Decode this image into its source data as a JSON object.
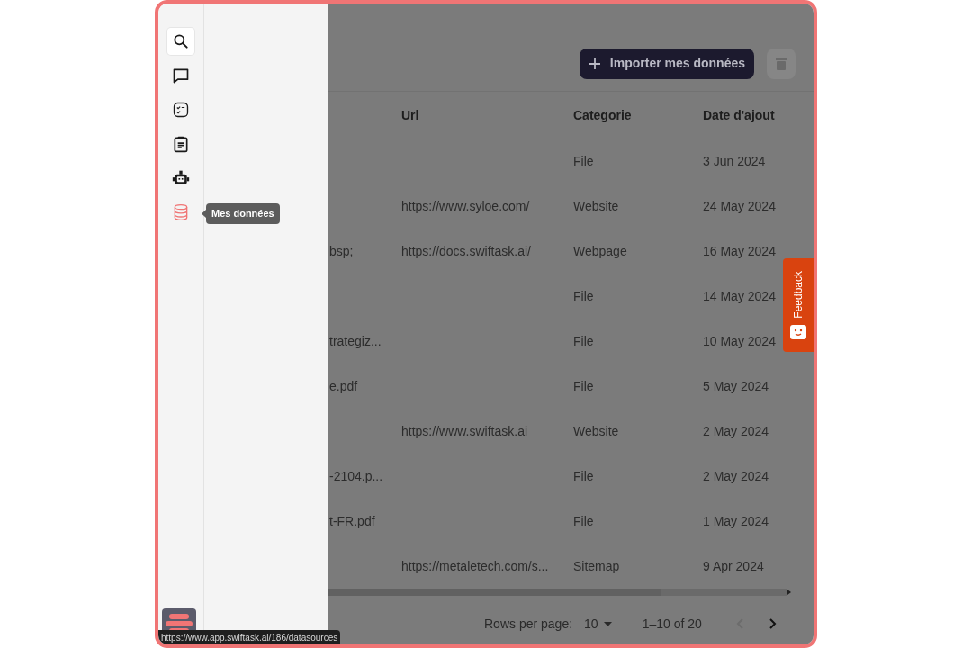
{
  "sidebar": {
    "items": [
      {
        "kind": "search",
        "selected": false,
        "focused": true
      },
      {
        "kind": "chat",
        "selected": false,
        "focused": false
      },
      {
        "kind": "checklist",
        "selected": false,
        "focused": false
      },
      {
        "kind": "clipboard",
        "selected": false,
        "focused": false
      },
      {
        "kind": "robot",
        "selected": false,
        "focused": false
      },
      {
        "kind": "database",
        "selected": true,
        "focused": false
      }
    ],
    "tooltip": "Mes données"
  },
  "toolbar": {
    "import_button": "Importer mes données",
    "delete_disabled": true
  },
  "table": {
    "columns": [
      "Url",
      "Categorie",
      "Date d'ajout"
    ],
    "rows": [
      {
        "column_1": "",
        "url": "",
        "category": "File",
        "date": "3 Jun 2024"
      },
      {
        "column_1": "",
        "url": "https://www.syloe.com/",
        "category": "Website",
        "date": "24 May 2024"
      },
      {
        "column_1": "bsp;",
        "url": "https://docs.swiftask.ai/",
        "category": "Webpage",
        "date": "16 May 2024"
      },
      {
        "column_1": "",
        "url": "",
        "category": "File",
        "date": "14 May 2024"
      },
      {
        "column_1": "trategiz...",
        "url": "",
        "category": "File",
        "date": "10 May 2024"
      },
      {
        "column_1": "e.pdf",
        "url": "",
        "category": "File",
        "date": "5 May 2024"
      },
      {
        "column_1": "",
        "url": "https://www.swiftask.ai",
        "category": "Website",
        "date": "2 May 2024"
      },
      {
        "column_1": "-2104.p...",
        "url": "",
        "category": "File",
        "date": "2 May 2024"
      },
      {
        "column_1": "t-FR.pdf",
        "url": "",
        "category": "File",
        "date": "1 May 2024"
      },
      {
        "column_1": "",
        "url": "https://metaletech.com/s...",
        "category": "Sitemap",
        "date": "9 Apr 2024"
      }
    ]
  },
  "pagination": {
    "rows_per_page_label": "Rows per page:",
    "rows_per_page": "10",
    "range": "1–10 of 20",
    "prev_disabled": true,
    "next_disabled": false
  },
  "feedback_tab": "Feedback",
  "status_url": "https://www.app.swiftask.ai/186/datasources"
}
